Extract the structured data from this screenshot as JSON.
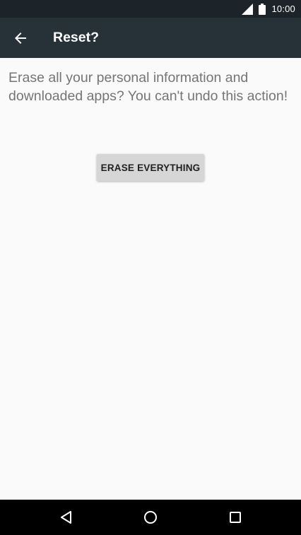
{
  "status_bar": {
    "time": "10:00",
    "signal_icon": "signal-icon",
    "battery_icon": "battery-icon"
  },
  "toolbar": {
    "back_icon": "arrow-back-icon",
    "title": "Reset?"
  },
  "content": {
    "message": "Erase all your personal information and downloaded apps? You can't undo this action!",
    "erase_button_label": "ERASE EVERYTHING"
  },
  "nav_bar": {
    "back_icon": "triangle-back-icon",
    "home_icon": "circle-home-icon",
    "recent_icon": "square-recents-icon"
  },
  "colors": {
    "status_bar": "#1c2429",
    "toolbar": "#263238",
    "background": "#fafafa",
    "message_text": "#757575",
    "button_bg": "#d6d6d6",
    "nav_bar": "#000000"
  }
}
